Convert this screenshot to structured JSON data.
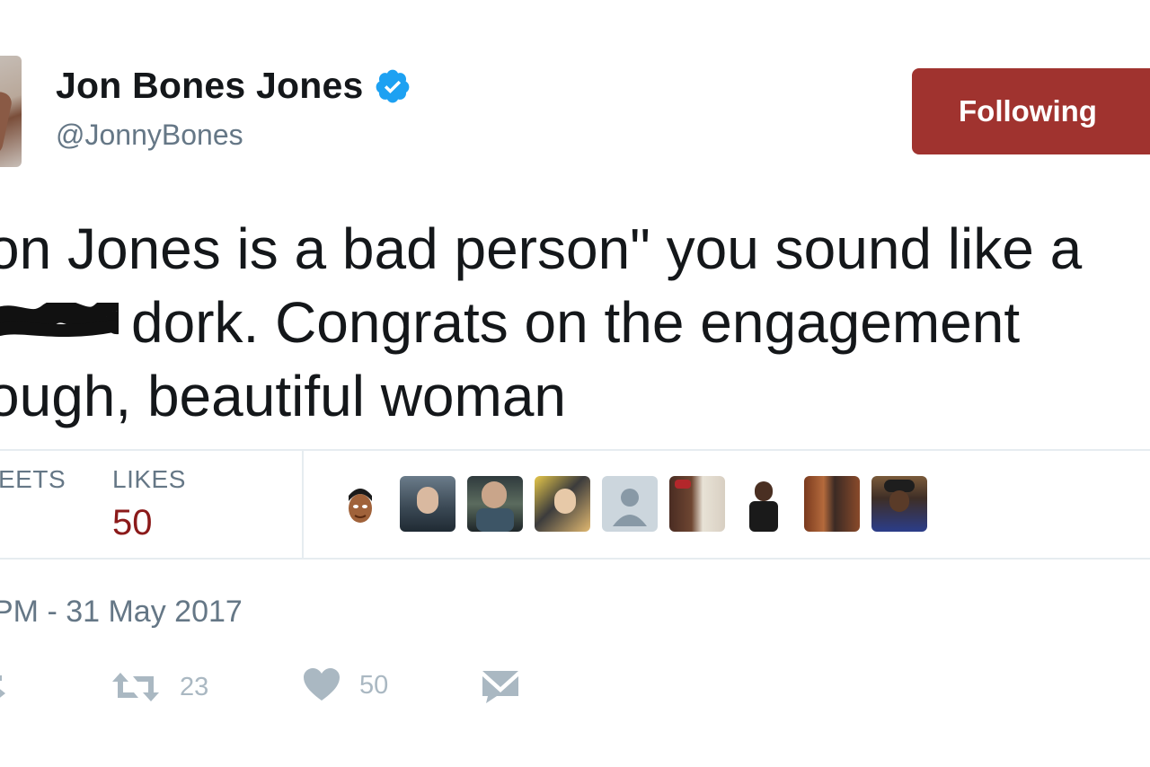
{
  "user": {
    "name": "Jon Bones Jones",
    "handle": "@JonnyBones"
  },
  "follow_button": {
    "label": "Following"
  },
  "tweet": {
    "lines": [
      "on Jones is a bad person\" you sound like a",
      "dork. Congrats on the engagement",
      "ough, beautiful woman"
    ]
  },
  "stats": {
    "retweets_label": "EETS",
    "likes_label": "LIKES",
    "likes_value": "50"
  },
  "likers": [
    {
      "icon": "cartoon-avatar"
    },
    {
      "icon": "user-photo-1"
    },
    {
      "icon": "user-photo-2"
    },
    {
      "icon": "user-photo-3"
    },
    {
      "icon": "default-avatar"
    },
    {
      "icon": "user-photo-4"
    },
    {
      "icon": "user-photo-5"
    },
    {
      "icon": "user-photo-6"
    },
    {
      "icon": "user-photo-7"
    }
  ],
  "timestamp": "PM - 31 May 2017",
  "actions": {
    "reply_icon": "reply-icon",
    "retweet_count": "23",
    "like_count": "50",
    "dm_icon": "envelope-icon"
  },
  "colors": {
    "follow_button_bg": "#a0332f",
    "likes_value": "#8b1a1a",
    "verified_badge": "#1da1f2",
    "muted_text": "#657786"
  }
}
